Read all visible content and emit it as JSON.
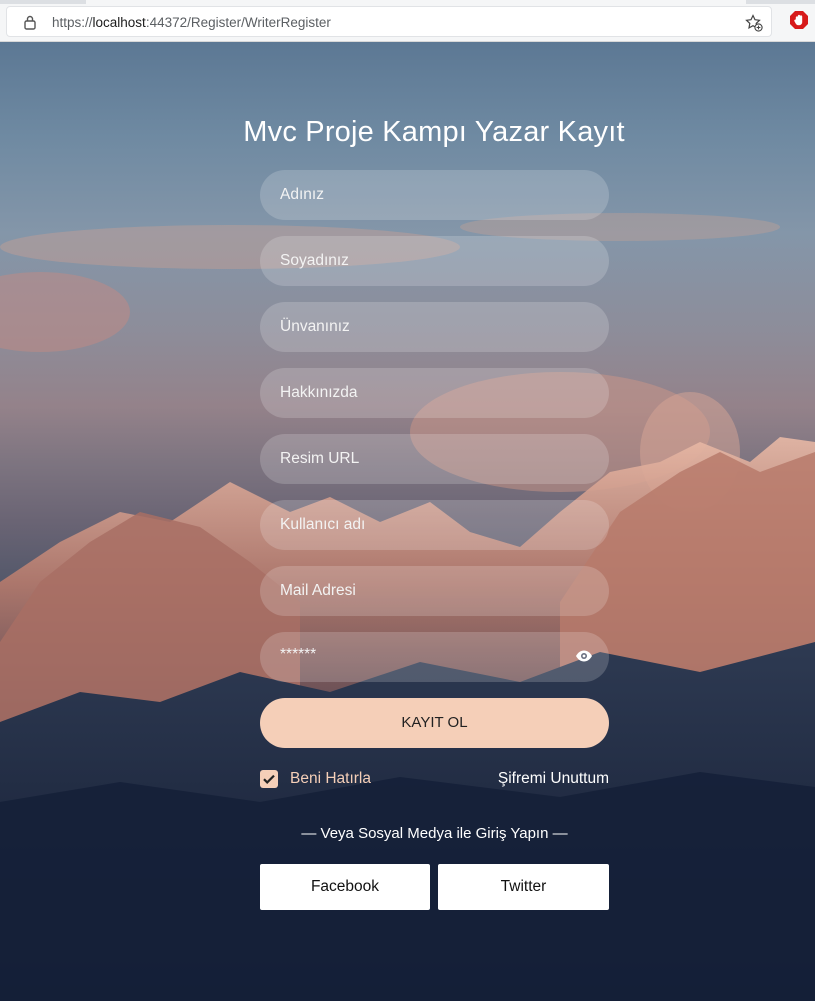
{
  "browser": {
    "url_prefix": "https://",
    "url_host": "localhost",
    "url_rest": ":44372/Register/WriterRegister",
    "icons": [
      "lock-icon",
      "favorites-icon",
      "extension-icon"
    ]
  },
  "page": {
    "title": "Mvc Proje Kampı Yazar Kayıt",
    "fields": [
      {
        "placeholder": "Adınız"
      },
      {
        "placeholder": "Soyadınız"
      },
      {
        "placeholder": "Ünvanınız"
      },
      {
        "placeholder": "Hakkınızda"
      },
      {
        "placeholder": "Resim URL"
      },
      {
        "placeholder": "Kullanıcı adı"
      },
      {
        "placeholder": "Mail Adresi"
      },
      {
        "placeholder": "******",
        "icon": "eye-icon"
      }
    ],
    "submit_label": "KAYIT OL",
    "remember_label": "Beni Hatırla",
    "remember_checked": true,
    "forgot_label": "Şifremi Unuttum",
    "social_label": "— Veya Sosyal Medya ile Giriş Yapın —",
    "facebook_label": "Facebook",
    "twitter_label": "Twitter"
  },
  "colors": {
    "accent": "#f5cfb8",
    "text": "#ffffff",
    "field_bg": "rgba(255,255,255,0.18)"
  }
}
